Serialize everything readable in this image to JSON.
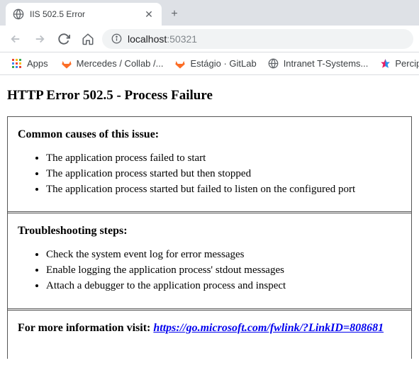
{
  "browser": {
    "tab": {
      "title": "IIS 502.5 Error"
    },
    "address": {
      "host": "localhost",
      "port": ":50321"
    },
    "bookmarks": {
      "apps_label": "Apps",
      "items": [
        {
          "label": "Mercedes / Collab /..."
        },
        {
          "label": "Estágio · GitLab"
        },
        {
          "label": "Intranet T-Systems..."
        },
        {
          "label": "Percipio"
        }
      ]
    }
  },
  "page": {
    "title": "HTTP Error 502.5 - Process Failure",
    "sections": [
      {
        "heading": "Common causes of this issue:",
        "items": [
          "The application process failed to start",
          "The application process started but then stopped",
          "The application process started but failed to listen on the configured port"
        ]
      },
      {
        "heading": "Troubleshooting steps:",
        "items": [
          "Check the system event log for error messages",
          "Enable logging the application process' stdout messages",
          "Attach a debugger to the application process and inspect"
        ]
      }
    ],
    "more_info": {
      "label": "For more information visit: ",
      "link_text": "https://go.microsoft.com/fwlink/?LinkID=808681"
    }
  }
}
